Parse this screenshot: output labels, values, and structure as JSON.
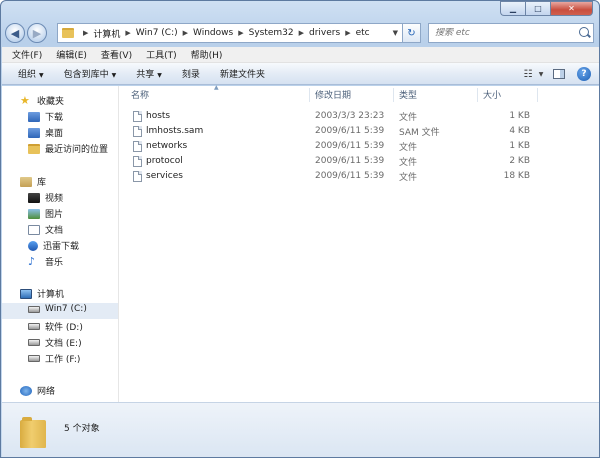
{
  "window": {
    "minimize_glyph": "▁",
    "maximize_glyph": "□",
    "close_glyph": "✕"
  },
  "nav": {
    "back_glyph": "◀",
    "forward_glyph": "▶",
    "breadcrumb": [
      "计算机",
      "Win7 (C:)",
      "Windows",
      "System32",
      "drivers",
      "etc"
    ],
    "refresh_glyph": "↻",
    "search_placeholder": "搜索 etc"
  },
  "menu": [
    "文件(F)",
    "编辑(E)",
    "查看(V)",
    "工具(T)",
    "帮助(H)"
  ],
  "toolbar": {
    "organize": "组织",
    "include_library": "包含到库中",
    "share": "共享",
    "burn": "刻录",
    "new_folder": "新建文件夹",
    "help_glyph": "?"
  },
  "sidebar": {
    "favorites_label": "收藏夹",
    "favorites": [
      "下载",
      "桌面",
      "最近访问的位置"
    ],
    "libraries_label": "库",
    "libraries": [
      "视频",
      "图片",
      "文档",
      "迅雷下载",
      "音乐"
    ],
    "computer_label": "计算机",
    "drives": [
      "Win7 (C:)",
      "软件 (D:)",
      "文档 (E:)",
      "工作 (F:)"
    ],
    "network_label": "网络"
  },
  "columns": {
    "name": "名称",
    "date": "修改日期",
    "type": "类型",
    "size": "大小"
  },
  "files": [
    {
      "name": "hosts",
      "date": "2003/3/3 23:23",
      "type": "文件",
      "size": "1 KB"
    },
    {
      "name": "lmhosts.sam",
      "date": "2009/6/11 5:39",
      "type": "SAM 文件",
      "size": "4 KB"
    },
    {
      "name": "networks",
      "date": "2009/6/11 5:39",
      "type": "文件",
      "size": "1 KB"
    },
    {
      "name": "protocol",
      "date": "2009/6/11 5:39",
      "type": "文件",
      "size": "2 KB"
    },
    {
      "name": "services",
      "date": "2009/6/11 5:39",
      "type": "文件",
      "size": "18 KB"
    }
  ],
  "status": {
    "count": "5 个对象"
  }
}
